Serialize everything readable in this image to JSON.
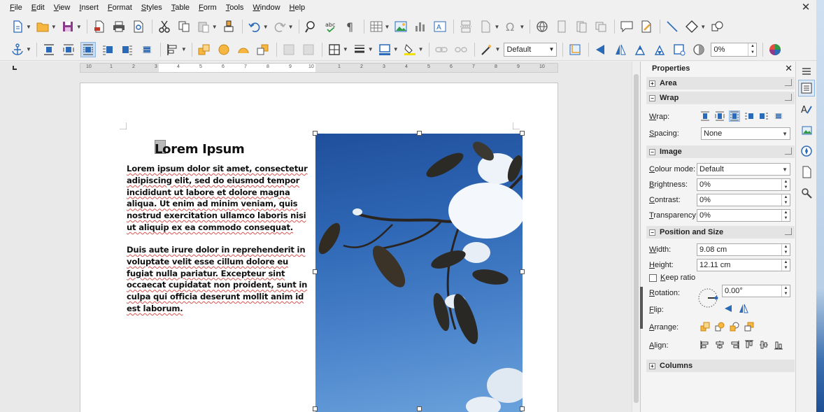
{
  "menu": [
    "File",
    "Edit",
    "View",
    "Insert",
    "Format",
    "Styles",
    "Table",
    "Form",
    "Tools",
    "Window",
    "Help"
  ],
  "toolbar2": {
    "frame_style": "Default",
    "transparency": "0%"
  },
  "document": {
    "heading": "Lorem Ipsum",
    "paragraph1": "Lorem ipsum dolor sit amet, consectetur adipiscing elit, sed do eiusmod tempor incididunt ut labore et dolore magna aliqua. Ut enim ad minim veniam, quis nostrud exercitation ullamco laboris nisi ut aliquip ex ea commodo consequat.",
    "paragraph2": "Duis aute irure dolor in reprehenderit in voluptate velit esse cillum dolore eu fugiat nulla pariatur. Excepteur sint occaecat cupidatat non proident, sunt in culpa qui officia deserunt mollit anim id est laborum.",
    "ruler_ticks": [
      "10",
      "1",
      "2",
      "3",
      "4",
      "5",
      "6",
      "7",
      "8",
      "9",
      "10",
      "1",
      "2",
      "3",
      "4",
      "5",
      "6",
      "7",
      "8",
      "9",
      "10"
    ]
  },
  "sidebar": {
    "title": "Properties",
    "area": {
      "title": "Area"
    },
    "wrap": {
      "title": "Wrap",
      "wrap_label": "Wrap:",
      "spacing_label": "Spacing:",
      "spacing_value": "None"
    },
    "image": {
      "title": "Image",
      "colour_mode_label": "Colour mode:",
      "colour_mode_value": "Default",
      "brightness_label": "Brightness:",
      "brightness_value": "0%",
      "contrast_label": "Contrast:",
      "contrast_value": "0%",
      "transparency_label": "Transparency:",
      "transparency_value": "0%"
    },
    "position_size": {
      "title": "Position and Size",
      "width_label": "Width:",
      "width_value": "9.08 cm",
      "height_label": "Height:",
      "height_value": "12.11 cm",
      "keep_ratio_label": "Keep ratio",
      "rotation_label": "Rotation:",
      "rotation_value": "0.00°",
      "flip_label": "Flip:",
      "arrange_label": "Arrange:",
      "align_label": "Align:"
    },
    "columns": {
      "title": "Columns"
    }
  },
  "colors": {
    "accent": "#2a6ab8",
    "sky": "#3d78c4",
    "spell_underline": "#d9534f"
  }
}
